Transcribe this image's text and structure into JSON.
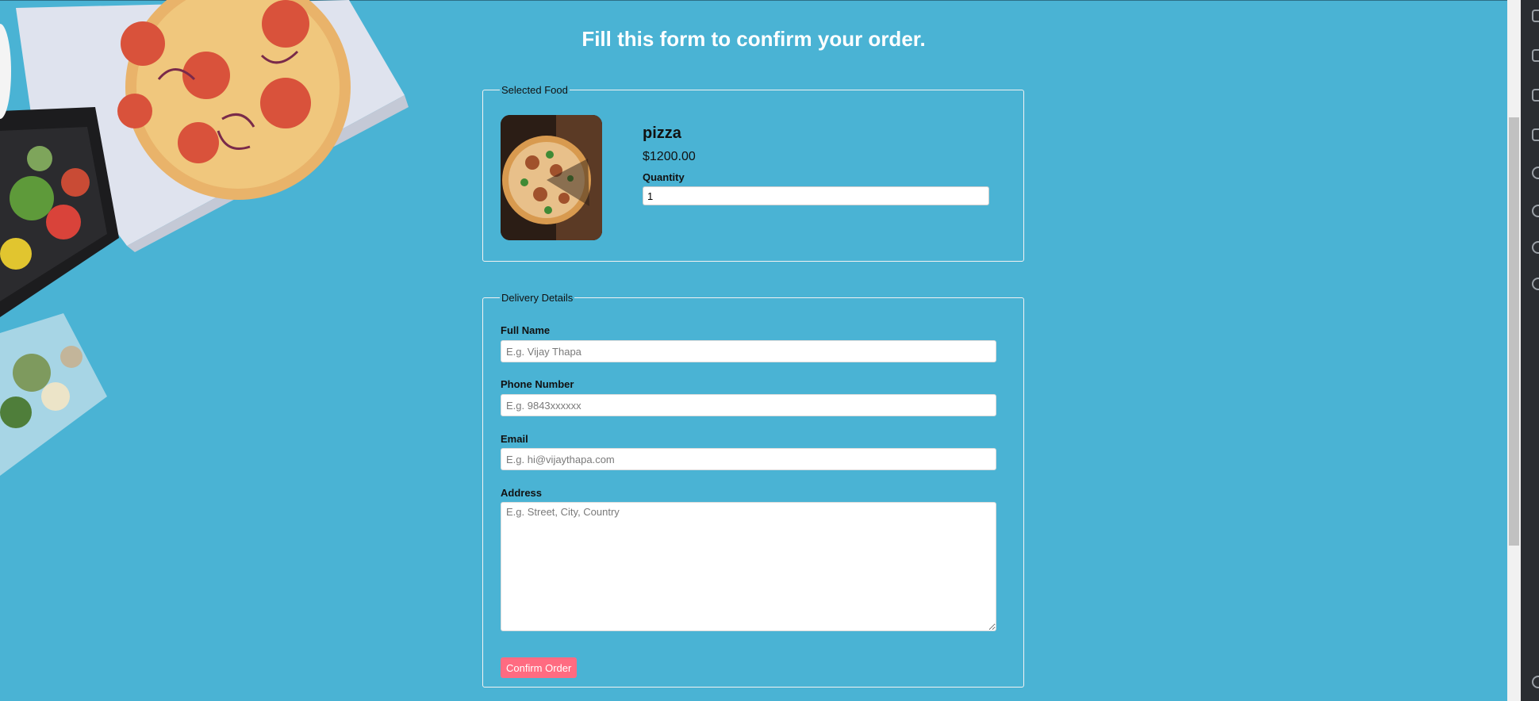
{
  "header": {
    "title": "Fill this form to confirm your order."
  },
  "selected_food": {
    "legend": "Selected Food",
    "name": "pizza",
    "price": "$1200.00",
    "quantity_label": "Quantity",
    "quantity_value": "1"
  },
  "delivery": {
    "legend": "Delivery Details",
    "full_name": {
      "label": "Full Name",
      "placeholder": "E.g. Vijay Thapa"
    },
    "phone": {
      "label": "Phone Number",
      "placeholder": "E.g. 9843xxxxxx"
    },
    "email": {
      "label": "Email",
      "placeholder": "E.g. hi@vijaythapa.com"
    },
    "address": {
      "label": "Address",
      "placeholder": "E.g. Street, City, Country"
    },
    "submit_label": "Confirm Order"
  },
  "colors": {
    "background": "#4ab3d4",
    "button": "#ff6b81",
    "border": "#f2f2f2"
  }
}
